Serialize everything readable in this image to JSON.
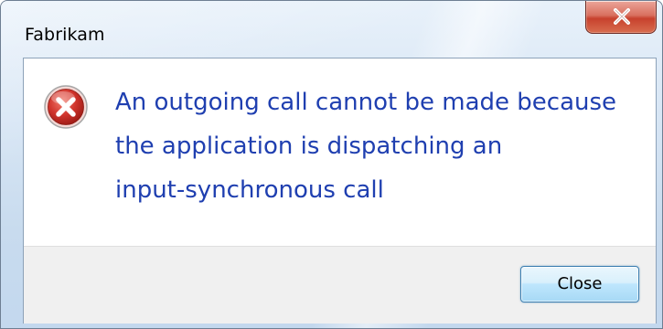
{
  "window": {
    "title": "Fabrikam"
  },
  "titlebar": {
    "close_icon": "close-x-icon"
  },
  "dialog": {
    "icon": "error-icon",
    "message": "An outgoing call cannot be made because\nthe application is dispatching an\ninput-synchronous call",
    "close_label": "Close"
  },
  "colors": {
    "message_text": "#1f3fb0",
    "error_icon_red": "#d0342c",
    "button_border": "#3c7fb1",
    "button_bar_bg": "#f0f0f0",
    "titlebar_close_red": "#c7412d"
  }
}
